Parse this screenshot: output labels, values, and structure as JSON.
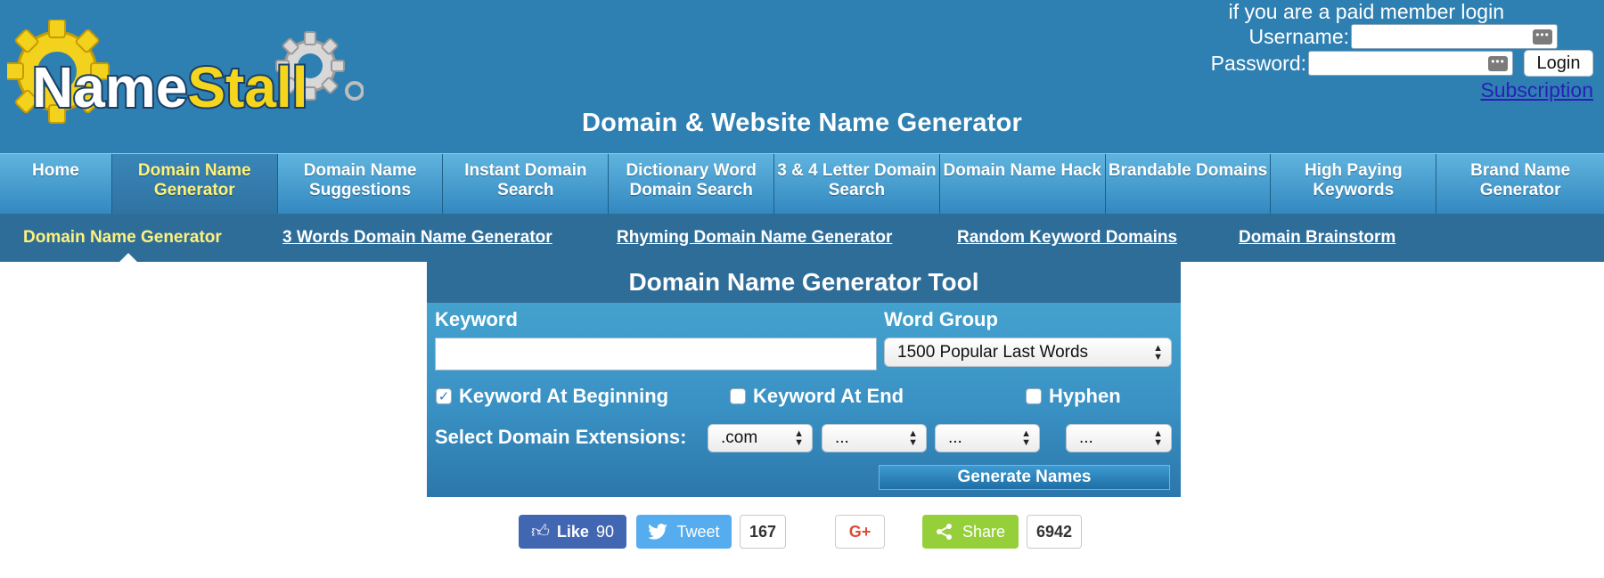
{
  "logo": {
    "text_name": "Name",
    "text_stall": "Stall"
  },
  "header": {
    "title": "Domain & Website Name Generator"
  },
  "login": {
    "note": "if you are a paid member login",
    "username_label": "Username:",
    "password_label": "Password:",
    "login_label": "Login",
    "subscription_label": "Subscription"
  },
  "nav": {
    "items": [
      {
        "label": "Home"
      },
      {
        "label": "Domain Name Generator"
      },
      {
        "label": "Domain Name Suggestions"
      },
      {
        "label": "Instant Domain Search"
      },
      {
        "label": "Dictionary Word Domain Search"
      },
      {
        "label": "3 & 4 Letter Domain Search"
      },
      {
        "label": "Domain Name Hack"
      },
      {
        "label": "Brandable Domains"
      },
      {
        "label": "High Paying Keywords"
      },
      {
        "label": "Brand Name Generator"
      }
    ]
  },
  "subnav": {
    "items": [
      {
        "label": "Domain Name Generator"
      },
      {
        "label": "3 Words Domain Name Generator"
      },
      {
        "label": "Rhyming Domain Name Generator"
      },
      {
        "label": "Random Keyword Domains"
      },
      {
        "label": "Domain Brainstorm"
      }
    ]
  },
  "tool": {
    "title": "Domain Name Generator Tool",
    "keyword_label": "Keyword",
    "keyword_value": "",
    "word_group_label": "Word Group",
    "word_group_value": "1500 Popular Last Words",
    "cb_beginning": "Keyword At Beginning",
    "cb_end": "Keyword At End",
    "cb_hyphen": "Hyphen",
    "extensions_label": "Select Domain Extensions:",
    "ext1": ".com",
    "ext2": "...",
    "ext3": "...",
    "ext4": "...",
    "generate_label": "Generate Names"
  },
  "social": {
    "like_label": "Like",
    "like_count": "90",
    "tweet_label": "Tweet",
    "tweet_count": "167",
    "gplus_label": "G+",
    "share_label": "Share",
    "share_count": "6942"
  },
  "colors": {
    "header_bg": "#2f80b2",
    "nav_active_text": "#fff27a",
    "facebook": "#4267b2",
    "twitter": "#55acee",
    "share": "#95d03a"
  }
}
